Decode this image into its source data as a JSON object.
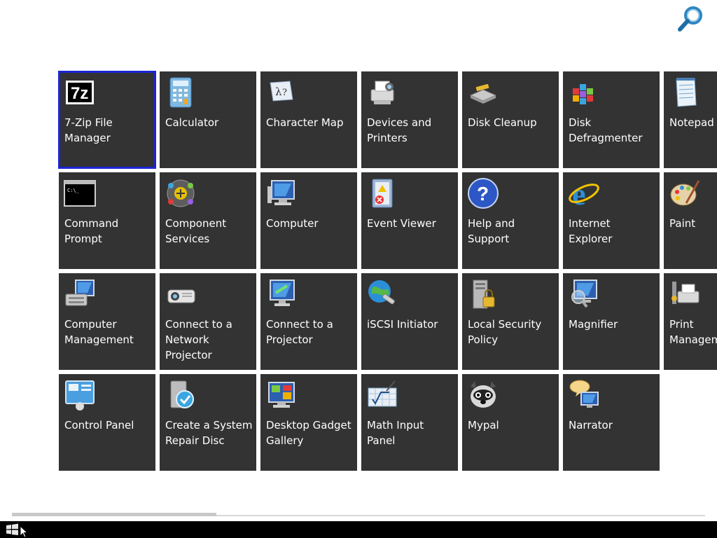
{
  "search": {
    "icon": "search-icon"
  },
  "tiles": [
    {
      "label": "7-Zip File\nManager",
      "icon": "7zip-icon",
      "selected": true
    },
    {
      "label": "Calculator",
      "icon": "calculator-icon"
    },
    {
      "label": "Character Map",
      "icon": "character-map-icon"
    },
    {
      "label": "Devices and\nPrinters",
      "icon": "printer-icon"
    },
    {
      "label": "Disk Cleanup",
      "icon": "disk-cleanup-icon"
    },
    {
      "label": "Disk\nDefragmenter",
      "icon": "defragmenter-icon"
    },
    {
      "label": "Notepad",
      "icon": "notepad-icon"
    },
    {
      "label": "Command\nPrompt",
      "icon": "command-prompt-icon"
    },
    {
      "label": "Component\nServices",
      "icon": "component-services-icon"
    },
    {
      "label": "Computer",
      "icon": "computer-icon"
    },
    {
      "label": "Event Viewer",
      "icon": "event-viewer-icon"
    },
    {
      "label": "Help and\nSupport",
      "icon": "help-icon"
    },
    {
      "label": "Internet Explorer",
      "icon": "internet-explorer-icon"
    },
    {
      "label": "Paint",
      "icon": "paint-icon"
    },
    {
      "label": "Computer\nManagement",
      "icon": "computer-management-icon"
    },
    {
      "label": "Connect to a\nNetwork\nProjector",
      "icon": "network-projector-icon"
    },
    {
      "label": "Connect to a\nProjector",
      "icon": "projector-icon"
    },
    {
      "label": "iSCSI Initiator",
      "icon": "iscsi-icon"
    },
    {
      "label": "Local Security\nPolicy",
      "icon": "security-policy-icon"
    },
    {
      "label": "Magnifier",
      "icon": "magnifier-icon"
    },
    {
      "label": "Print\nManagem",
      "icon": "print-management-icon"
    },
    {
      "label": "Control Panel",
      "icon": "control-panel-icon"
    },
    {
      "label": "Create a System\nRepair Disc",
      "icon": "repair-disc-icon"
    },
    {
      "label": "Desktop Gadget\nGallery",
      "icon": "gadget-gallery-icon"
    },
    {
      "label": "Math Input Panel",
      "icon": "math-input-icon"
    },
    {
      "label": "Mypal",
      "icon": "mypal-icon"
    },
    {
      "label": "Narrator",
      "icon": "narrator-icon"
    }
  ],
  "scrollbar": {
    "position": 0.0
  },
  "taskbar": {
    "start_icon": "windows-logo-icon"
  },
  "colors": {
    "tile": "#333333",
    "selection": "#1a25d6",
    "taskbar": "#000000"
  }
}
